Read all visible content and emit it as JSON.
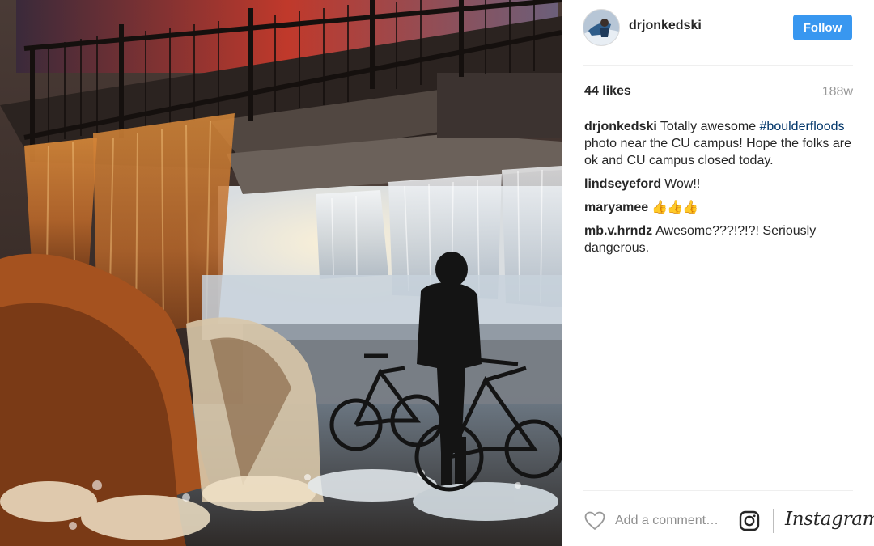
{
  "post": {
    "image_alt": "Person with bicycles under a bridge as floodwater pours over at night",
    "icons": {
      "avatar": "avatar-photo",
      "like": "heart-outline-icon",
      "instagram": "instagram-camera-icon"
    }
  },
  "header": {
    "username": "drjonkedski",
    "follow_label": "Follow"
  },
  "stats": {
    "likes": "44 likes",
    "age": "188w"
  },
  "caption": {
    "author": "drjonkedski",
    "text_before": "Totally awesome ",
    "hashtag": "#boulderfloods",
    "text_after": " photo near the CU campus! Hope the folks are ok and CU campus closed today."
  },
  "comments": [
    {
      "author": "lindseyeford",
      "text": "Wow!!"
    },
    {
      "author": "maryamee",
      "text": "👍👍👍"
    },
    {
      "author": "mb.v.hrndz",
      "text": "Awesome???!?!?! Seriously dangerous."
    }
  ],
  "footer": {
    "comment_placeholder": "Add a comment…",
    "brand": "Instagram"
  },
  "colors": {
    "follow_button": "#3897f0",
    "hashtag": "#003569",
    "muted": "#999999"
  }
}
